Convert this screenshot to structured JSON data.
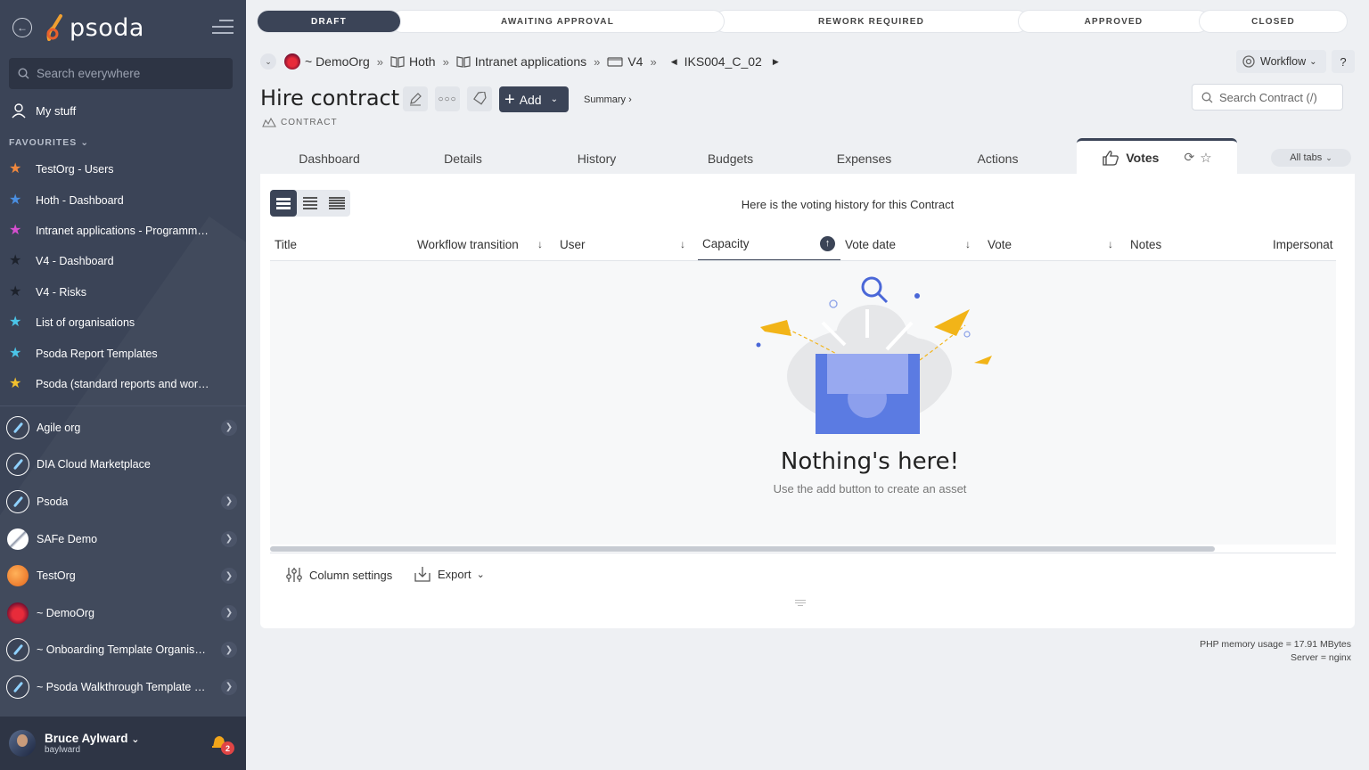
{
  "sidebar": {
    "logo_text": "psoda",
    "search_placeholder": "Search everywhere",
    "my_stuff": "My stuff",
    "favourites_heading": "FAVOURITES",
    "favourites": [
      {
        "label": "TestOrg - Users",
        "color": "#f0883e"
      },
      {
        "label": "Hoth - Dashboard",
        "color": "#4a8fe2"
      },
      {
        "label": "Intranet applications - Programme…",
        "color": "#d64fd0"
      },
      {
        "label": "V4 - Dashboard",
        "color": "#2a2f3a"
      },
      {
        "label": "V4 - Risks",
        "color": "#2a2f3a"
      },
      {
        "label": "List of organisations",
        "color": "#4bc5e8"
      },
      {
        "label": "Psoda Report Templates",
        "color": "#4bc5e8"
      },
      {
        "label": "Psoda (standard reports and work…",
        "color": "#f2c12e"
      }
    ],
    "orgs": [
      {
        "label": "Agile org",
        "icon": "feather",
        "chevron": true
      },
      {
        "label": "DIA Cloud Marketplace",
        "icon": "feather",
        "chevron": false
      },
      {
        "label": "Psoda",
        "icon": "feather",
        "chevron": true
      },
      {
        "label": "SAFe Demo",
        "icon": "safe",
        "chevron": true
      },
      {
        "label": "TestOrg",
        "icon": "orange",
        "chevron": true
      },
      {
        "label": "~ DemoOrg",
        "icon": "demo",
        "chevron": true
      },
      {
        "label": "~ Onboarding Template Organisa…",
        "icon": "feather",
        "chevron": true
      },
      {
        "label": "~ Psoda Walkthrough Template P…",
        "icon": "feather",
        "chevron": true
      }
    ],
    "user": {
      "name": "Bruce Aylward",
      "login": "baylward",
      "notifications": "2"
    }
  },
  "status": {
    "stages": [
      "DRAFT",
      "AWAITING APPROVAL",
      "REWORK REQUIRED",
      "APPROVED",
      "CLOSED"
    ],
    "active": "DRAFT"
  },
  "breadcrumb": {
    "items": [
      "~ DemoOrg",
      "Hoth",
      "Intranet applications",
      "V4",
      "IKS004_C_02"
    ]
  },
  "header": {
    "title": "Hire contract",
    "type_label": "CONTRACT",
    "add_label": "Add",
    "summary_label": "Summary ›",
    "search_placeholder": "Search Contract (/)",
    "workflow_label": "Workflow",
    "help_label": "?"
  },
  "tabs": {
    "items": [
      "Dashboard",
      "Details",
      "History",
      "Budgets",
      "Expenses",
      "Actions",
      "Votes"
    ],
    "active": "Votes",
    "all_tabs_label": "All tabs"
  },
  "votes": {
    "message": "Here is the voting history for this Contract",
    "columns": [
      "Title",
      "Workflow transition",
      "User",
      "Capacity",
      "Vote date",
      "Vote",
      "Notes",
      "Impersonat"
    ],
    "sorted_column": "Capacity",
    "empty_title": "Nothing's here!",
    "empty_sub": "Use the add button to create an asset",
    "column_settings_label": "Column settings",
    "export_label": "Export"
  },
  "footer": {
    "memory": "PHP memory usage = 17.91 MBytes",
    "server": "Server = nginx"
  }
}
